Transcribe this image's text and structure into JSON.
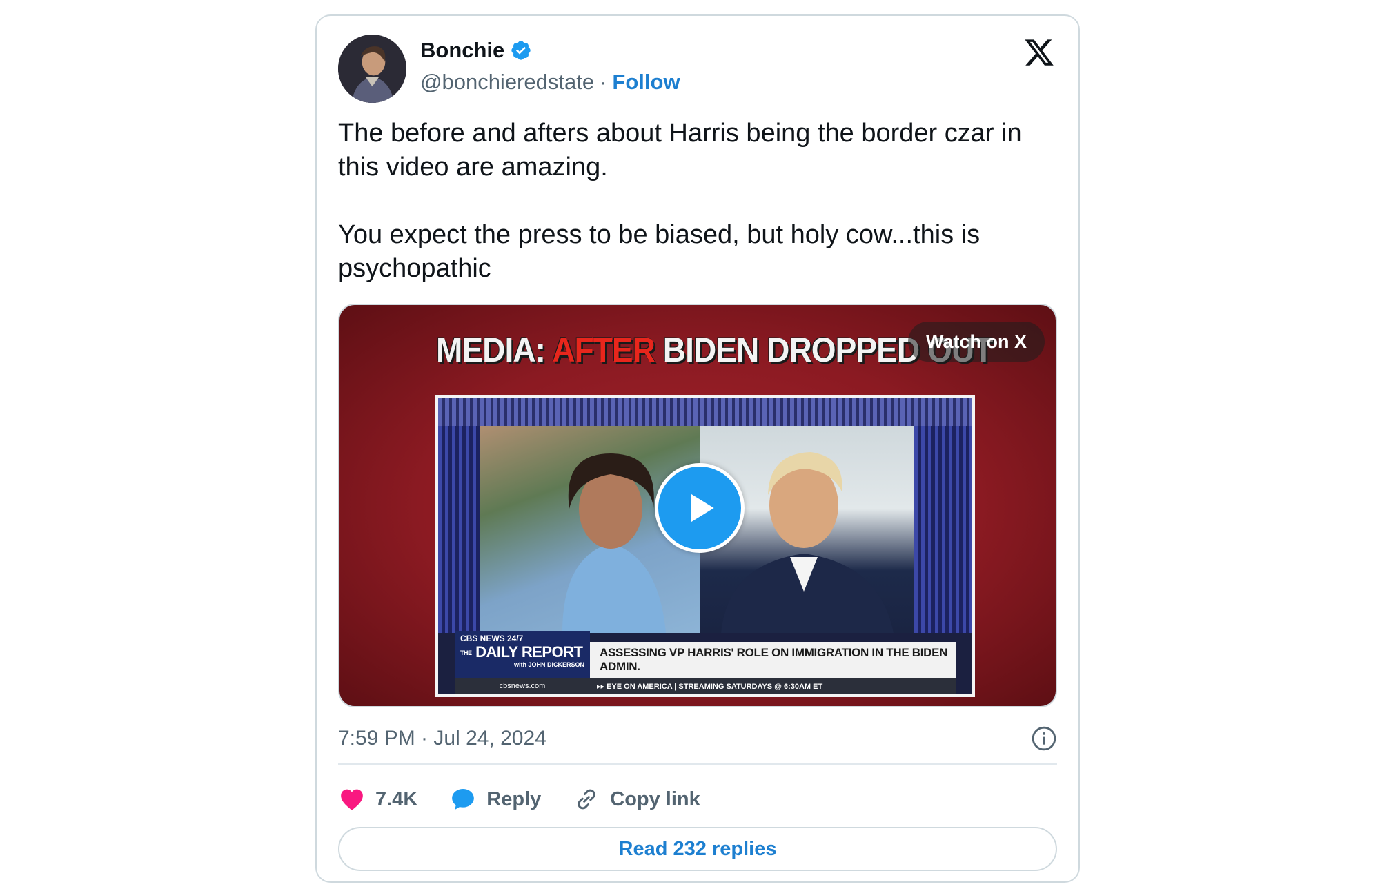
{
  "author": {
    "name": "Bonchie",
    "handle": "@bonchieredstate",
    "separator": "·",
    "follow_label": "Follow",
    "verified": true,
    "verified_color": "#1d9bf0"
  },
  "tweet": {
    "paragraph1": "The before and afters about Harris being the border czar in this video are amazing.",
    "paragraph2": "You expect the press to be biased, but holy cow...this is psychopathic",
    "timestamp": "7:59 PM · Jul 24, 2024"
  },
  "media": {
    "headline_part1": "MEDIA:",
    "headline_part2": "AFTER",
    "headline_part3": "BIDEN DROPPED OUT",
    "watch_label": "Watch on X",
    "network_tag": "CBS NEWS 24/7",
    "show_name": "DAILY REPORT",
    "show_prefix": "THE",
    "show_host": "with JOHN DICKERSON",
    "lower_third_headline": "ASSESSING VP HARRIS' ROLE ON IMMIGRATION IN THE BIDEN ADMIN.",
    "ticker_site": "cbsnews.com",
    "ticker_message": "▸▸ EYE ON AMERICA | STREAMING SATURDAYS @ 6:30AM ET"
  },
  "actions": {
    "likes": "7.4K",
    "reply_label": "Reply",
    "copy_link_label": "Copy link"
  },
  "read_replies_label": "Read 232 replies",
  "colors": {
    "accent": "#1d9bf0",
    "link": "#1d7fd0",
    "like": "#f91880",
    "muted": "#536471"
  }
}
